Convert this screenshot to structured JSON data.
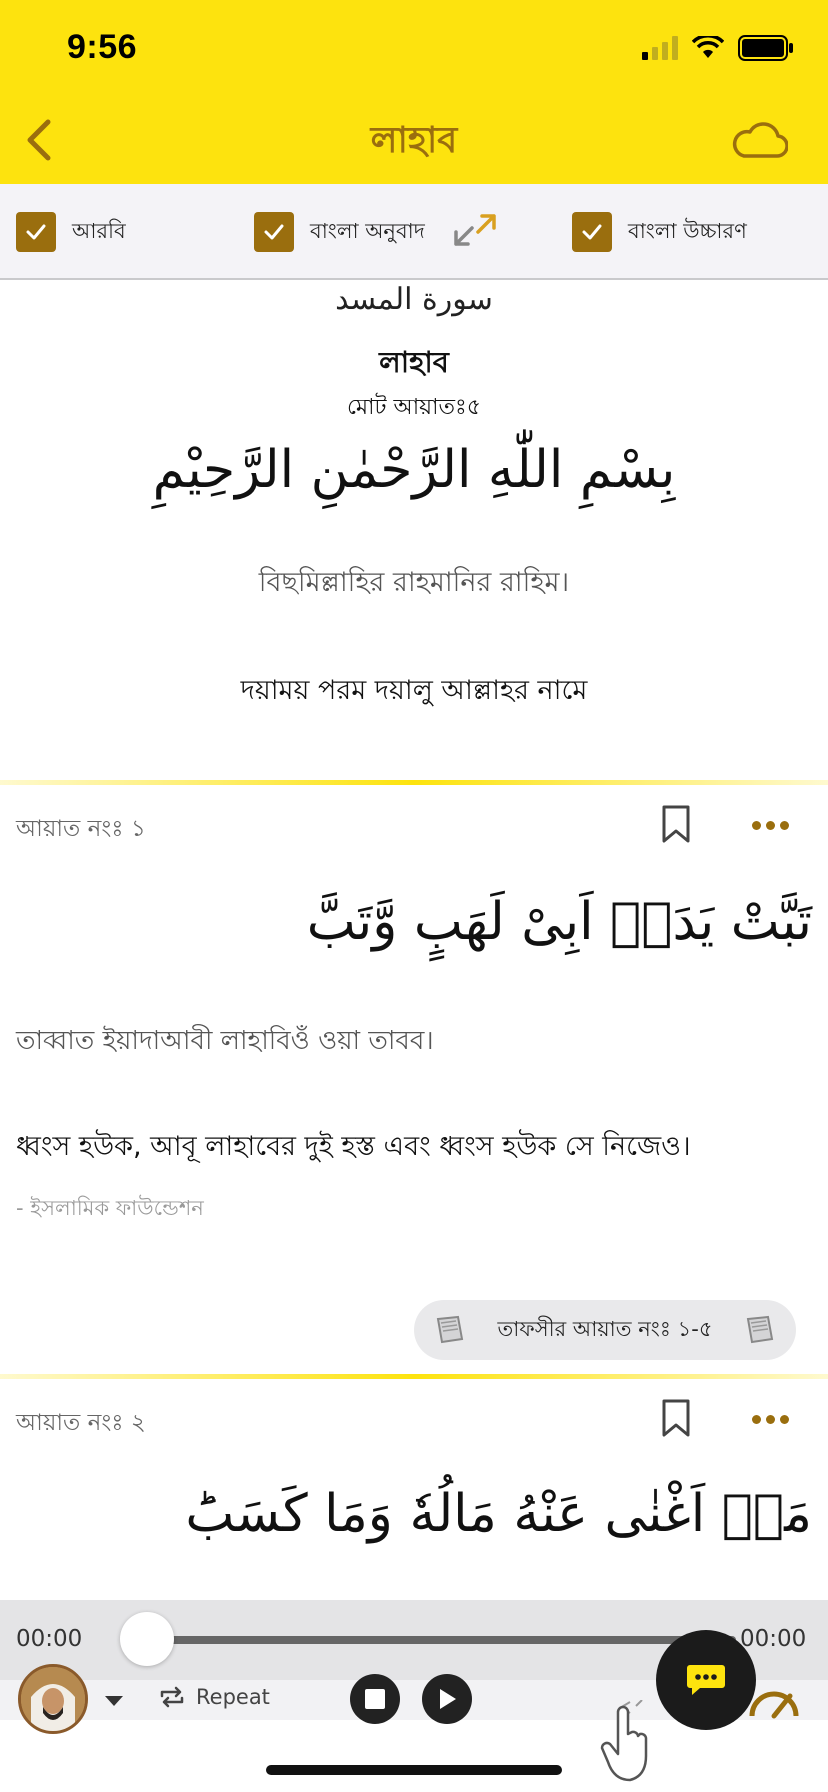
{
  "status_bar": {
    "time": "9:56"
  },
  "header": {
    "title": "লাহাব"
  },
  "options": [
    {
      "label": "আরবি",
      "checked": true
    },
    {
      "label": "বাংলা অনুবাদ",
      "checked": true
    },
    {
      "label": "বাংলা উচ্চারণ",
      "checked": true
    }
  ],
  "surah": {
    "arabic_name": "سورة المسد",
    "bangla_name": "লাহাব",
    "ayah_count": "মোট আয়াতঃ৫",
    "bismillah_ar": "بِسْمِ اللّٰهِ الرَّحْمٰنِ الرَّحِيْمِ",
    "bismillah_tr": "বিছমিল্লাহির রাহমানির রাহিম।",
    "bismillah_bn": "দয়াময় পরম দয়ালু আল্লাহর নামে"
  },
  "ayahs": [
    {
      "number_label": "আয়াত নংঃ ১",
      "arabic": "تَبَّتْ يَدَاۤ اَبِىْ لَهَبٍ وَّتَبَّ",
      "transliteration": "তাব্বাত ইয়াদাআবী লাহাবিওঁ ওয়া তাবব।",
      "translation": "ধ্বংস হউক, আবূ লাহাবের দুই হস্ত এবং ধ্বংস হউক সে নিজেও।",
      "source": "- ইসলামিক ফাউন্ডেশন",
      "tafsir": "তাফসীর আয়াত নংঃ ১-৫"
    },
    {
      "number_label": "আয়াত নংঃ ২",
      "arabic": "مَاۤ اَغْنٰى عَنْهُ مَالُهٗ وَمَا  كَسَبَؕ"
    }
  ],
  "player": {
    "current_time": "00:00",
    "total_time": "00:00",
    "repeat_label": "Repeat",
    "progress": 0
  },
  "colors": {
    "header": "#FDE30E",
    "accent": "#9A6E0E"
  }
}
